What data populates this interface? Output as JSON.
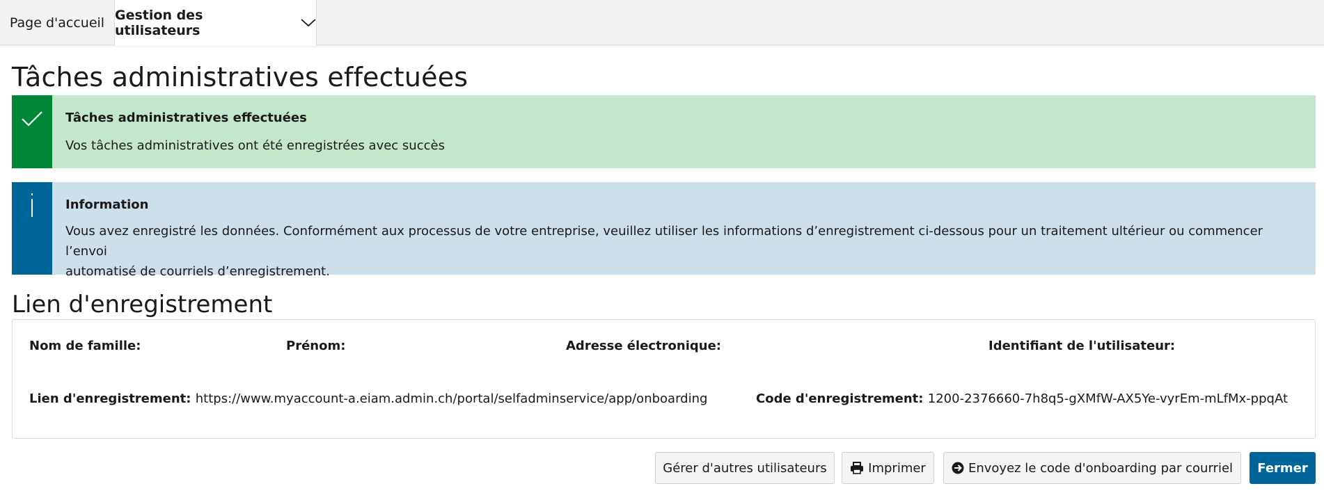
{
  "nav": {
    "tabs": [
      {
        "label": "Page d'accueil"
      },
      {
        "label": "Gestion des utilisateurs"
      }
    ]
  },
  "page": {
    "title": "Tâches administratives effectuées"
  },
  "alerts": {
    "success": {
      "title": "Tâches administratives effectuées",
      "text": "Vos tâches administratives ont été enregistrées avec succès",
      "color": "#008737",
      "background": "#c4e7cc"
    },
    "info": {
      "title": "Information",
      "line1": "Vous avez enregistré les données. Conformément aux processus de votre entreprise, veuillez utiliser les informations d’enregistrement ci-dessous pour un traitement ultérieur ou commencer l’envoi",
      "line2": "automatisé de courriels d’enregistrement.",
      "color": "#006699",
      "background": "#ccdfea"
    }
  },
  "registration": {
    "section_title": "Lien d'enregistrement",
    "fields": {
      "last_name_label": "Nom de famille:",
      "first_name_label": "Prénom:",
      "email_label": "Adresse électronique:",
      "user_id_label": "Identifiant de l'utilisateur:",
      "link_label": "Lien d'enregistrement:",
      "link_value": "https://www.myaccount-a.eiam.admin.ch/portal/selfadminservice/app/onboarding",
      "code_label": "Code d'enregistrement:",
      "code_value": "1200-2376660-7h8q5-gXMfW-AX5Ye-vyrEm-mLfMx-ppqAt"
    }
  },
  "actions": {
    "manage_others": "Gérer d'autres utilisateurs",
    "print": "Imprimer",
    "send_onboarding": "Envoyez le code d'onboarding par courriel",
    "close": "Fermer",
    "primary_color": "#006699"
  },
  "icons": {
    "tab_dropdown": "chevron-down-icon",
    "success": "checkmark-icon",
    "info": "info-icon",
    "print": "printer-icon",
    "send": "arrow-circle-right-icon"
  }
}
